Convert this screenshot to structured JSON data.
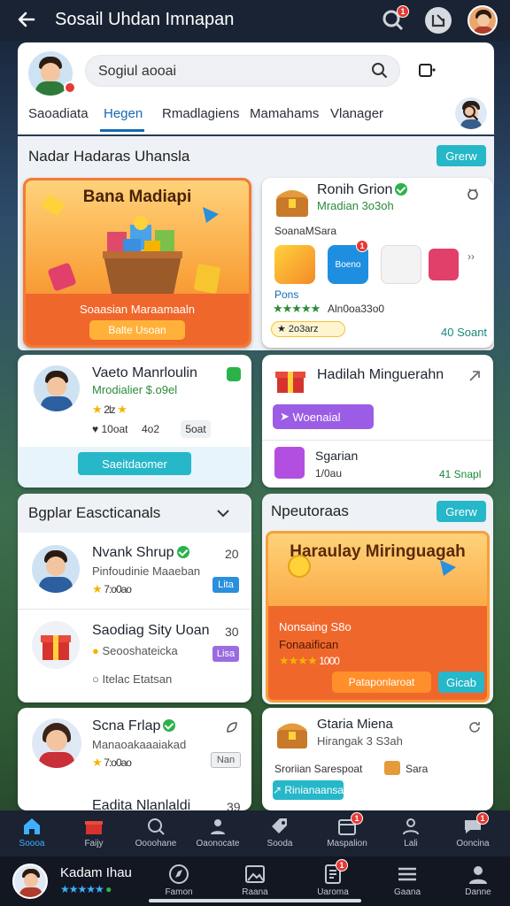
{
  "topbar": {
    "title": "Sosail Uhdan Imnapan",
    "notif_badge": "1"
  },
  "header": {
    "search_placeholder": "Sogiul aooai",
    "tabs": [
      "Saoadiata",
      "Hegen",
      "Rmadlagiens",
      "Mamahams",
      "Vlanager"
    ],
    "active_tab": 1
  },
  "featured": {
    "title": "Nadar Hadaras Uhansla",
    "button": "Grerw"
  },
  "promo": {
    "title": "Bana Madiapi",
    "subtitle": "Soaasian Maraamaaln",
    "button": "Balte Usoan"
  },
  "friend1": {
    "name": "Ronih Grion",
    "status": "Mradian 3o3oh",
    "line": "SoanaMSara",
    "caption": "Pons",
    "meta": "Aln0oa33o0",
    "count": "40 Soant",
    "badge": "1",
    "rating": "2o3arz"
  },
  "friend2": {
    "name": "Vaeto Manrloulin",
    "status": "Mrodialier $.o9el",
    "stars": "2lz",
    "meta1": "10oat",
    "meta2": "4o2",
    "meta3": "5oat",
    "button": "Saeitdaomer"
  },
  "gift1": {
    "title": "Hadilah Minguerahn",
    "chip": "Woenaial",
    "name": "Sgarian",
    "sub": "1/0au",
    "count": "41 Snapl"
  },
  "popular": {
    "title": "Bgplar Eascticanals",
    "rows": [
      {
        "name": "Nvank Shrup",
        "sub": "Pinfoudinie Maaeban",
        "rating": "7:o0ao",
        "num": "20",
        "tag": "Lita",
        "tag_color": "#2a8fdd"
      },
      {
        "name": "Saodiag Sity Uoan",
        "sub": "Seooshateicka",
        "rating": "",
        "num": "30",
        "tag": "Lisa",
        "tag_color": "#9b6ce0",
        "extra": "Itelac Etatsan"
      }
    ]
  },
  "nearby": {
    "title": "Npeutoraas",
    "button": "Grerw",
    "promo_title": "Haraulay Miringuagah",
    "line1": "Nonsaing S8o",
    "line2": "Fonaaifican",
    "rating": "1000",
    "btn_left": "Pataponlaroat",
    "btn_right": "Gicab"
  },
  "friend3": {
    "name": "Scna Frlap",
    "sub": "Manaoakaaaiakad",
    "rating": "7:o0ao",
    "tag": "Nan"
  },
  "gift2": {
    "title": "Gtaria Miena",
    "sub": "Hirangak 3 S3ah",
    "line": "Sroriian Sarespoat",
    "right": "Sara",
    "button": "Rinianaansa"
  },
  "partial": {
    "name": "Eadita Nlanlaldi",
    "num": "39"
  },
  "nav1": [
    "Soooa",
    "Faijy",
    "Oooohane",
    "Oaonocate",
    "Sooda",
    "Maspalion",
    "Lali",
    "Ooncina"
  ],
  "nav1_badges": {
    "Maspalion": "1",
    "Ooncina": "1"
  },
  "profile": {
    "name": "Kadam Ihau"
  },
  "nav2": [
    "Famon",
    "Raana",
    "Uaroma",
    "Gaana",
    "Danne"
  ],
  "nav2_badge": "1",
  "colors": {
    "accent": "#26b7c9",
    "topbar": "#1a2333",
    "nav": "#1b2232",
    "promo": "#f47a34"
  }
}
